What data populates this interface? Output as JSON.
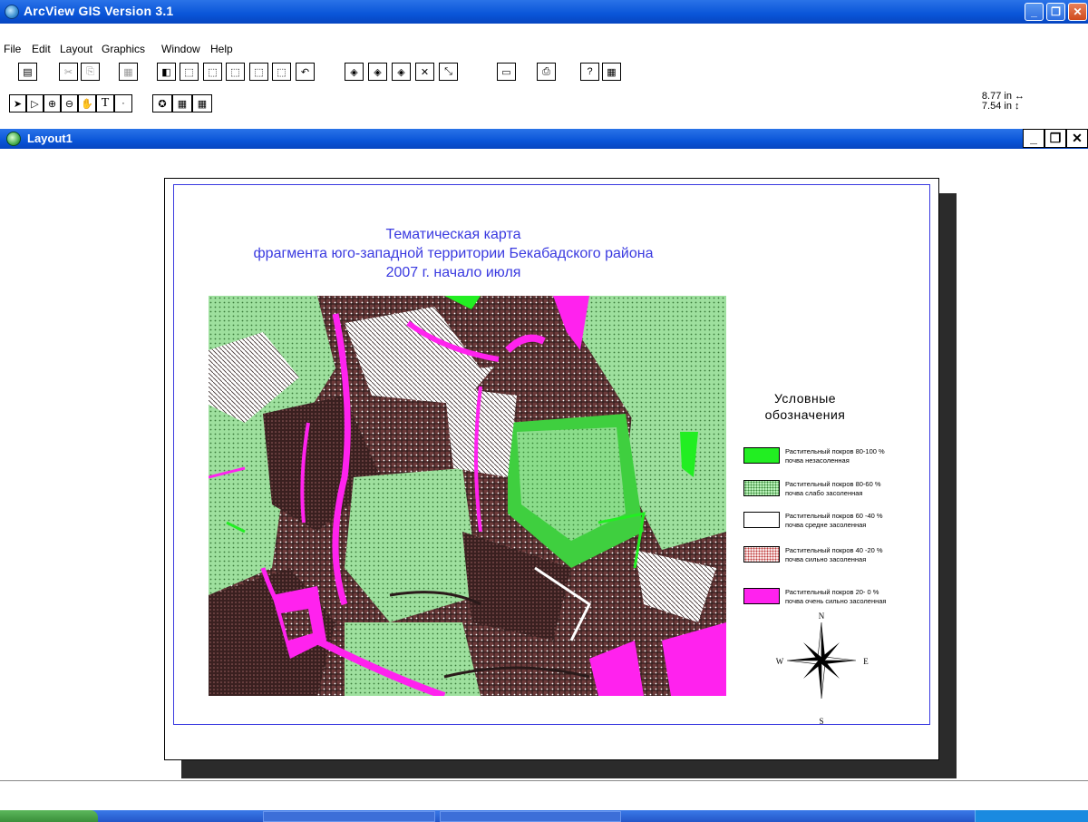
{
  "app": {
    "title": "ArcView GIS Version 3.1"
  },
  "menu": [
    "File",
    "Edit",
    "Layout",
    "Graphics",
    "Window",
    "Help"
  ],
  "toolbar_buttons": [
    "save-icon",
    "cut-icon",
    "copy-icon",
    "paste-icon",
    "properties-icon",
    "frame-icon",
    "frame2-icon",
    "frame3-icon",
    "frame4-icon",
    "undo-icon",
    "zoom-in-icon",
    "zoom-actual-icon",
    "zoom-out-icon",
    "zoom-full-icon",
    "zoom-page-icon",
    "page-icon",
    "print-icon",
    "help-icon",
    "grid-icon"
  ],
  "tools": [
    "pointer-icon",
    "vertex-icon",
    "zoom-in-tool-icon",
    "zoom-out-tool-icon",
    "pan-icon",
    "text-icon",
    "point-icon",
    "symbol-icon",
    "palette-icon"
  ],
  "coords": {
    "x": "8.77 in",
    "y": "7.54 in"
  },
  "layout": {
    "title": "Layout1"
  },
  "map": {
    "title_line1": "Тематическая карта",
    "title_line2": "фрагмента   юго-западной территории Бекабадского района",
    "title_line3": "2007 г. начало июля"
  },
  "legend": {
    "title_line1": "Условные",
    "title_line2": "обозначения",
    "items": [
      {
        "line1": "Растительный покров 80-100 %",
        "line2": "почва незасоленная",
        "color": "#22ee22",
        "pattern": "solid"
      },
      {
        "line1": "Растительный покров 80-60 %",
        "line2": "почва слабо засоленная",
        "color": "#b8f0b8",
        "pattern": "dots"
      },
      {
        "line1": "Растительный покров 60 -40 %",
        "line2": "почва средне засоленная",
        "color": "#ffffff",
        "pattern": "solid"
      },
      {
        "line1": "Растительный покров 40 -20 %",
        "line2": "почва сильно засоленная",
        "color": "#f4dcdc",
        "pattern": "dots-red"
      },
      {
        "line1": "Растительный покров 20- 0 %",
        "line2": "почва очень сильно засоленная",
        "color": "#ff22ee",
        "pattern": "solid"
      }
    ]
  },
  "compass": {
    "n": "N",
    "s": "S",
    "e": "E",
    "w": "W"
  }
}
